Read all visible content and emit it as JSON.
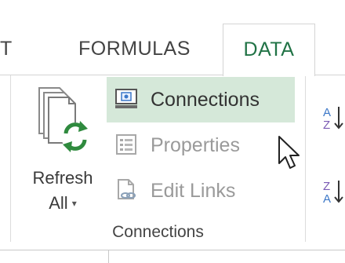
{
  "tabs": {
    "partial": "T",
    "formulas": "FORMULAS",
    "data": "DATA"
  },
  "connections_group": {
    "refresh_all": {
      "line1": "Refresh",
      "line2": "All",
      "arrow": "▾"
    },
    "connections": "Connections",
    "properties": "Properties",
    "edit_links": "Edit Links",
    "group_label": "Connections"
  },
  "sort_group": {
    "sort_az_icon": "sort-ascending-icon",
    "sort_za_icon": "sort-descending-icon"
  },
  "colors": {
    "accent": "#217346",
    "hover_bg": "#d5e8d9"
  }
}
